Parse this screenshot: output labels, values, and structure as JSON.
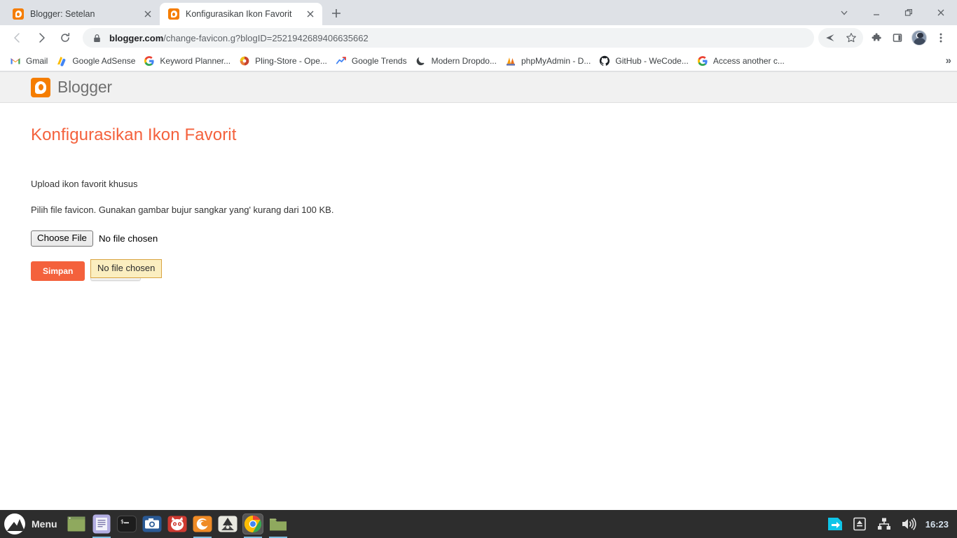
{
  "browser": {
    "tabs": [
      {
        "title": "Blogger: Setelan",
        "favicon": "blogger-icon",
        "active": false
      },
      {
        "title": "Konfigurasikan Ikon Favorit",
        "favicon": "blogger-icon",
        "active": true
      }
    ],
    "new_tab_label": "+",
    "window_controls": {
      "tab_search": "chevron-down-icon",
      "minimize": "minimize-icon",
      "maximize": "maximize-icon",
      "close": "close-icon"
    },
    "nav": {
      "back": "back-arrow-icon",
      "forward": "forward-arrow-icon",
      "reload": "reload-icon"
    },
    "omnibox": {
      "security": "lock-icon",
      "url_domain": "blogger.com",
      "url_path": "/change-favicon.g?blogID=2521942689406635662",
      "url_full": "blogger.com/change-favicon.g?blogID=2521942689406635662"
    },
    "toolbar_icons": [
      {
        "name": "share-icon"
      },
      {
        "name": "bookmark-star-icon"
      },
      {
        "name": "extensions-puzzle-icon"
      },
      {
        "name": "side-panel-icon"
      },
      {
        "name": "profile-avatar"
      },
      {
        "name": "chrome-menu-icon"
      }
    ],
    "bookmarks": [
      {
        "label": "Gmail",
        "icon": "gmail-icon"
      },
      {
        "label": "Google AdSense",
        "icon": "adsense-icon"
      },
      {
        "label": "Keyword Planner...",
        "icon": "google-g-icon"
      },
      {
        "label": "Pling-Store - Ope...",
        "icon": "pling-icon"
      },
      {
        "label": "Google Trends",
        "icon": "trends-icon"
      },
      {
        "label": "Modern Dropdo...",
        "icon": "moon-icon"
      },
      {
        "label": "phpMyAdmin - D...",
        "icon": "phpmyadmin-icon"
      },
      {
        "label": "GitHub - WeCode...",
        "icon": "github-icon"
      },
      {
        "label": "Access another c...",
        "icon": "google-g-icon"
      }
    ],
    "bookmarks_overflow": "»"
  },
  "page": {
    "brand": "Blogger",
    "brand_icon": "blogger-logo-icon",
    "title": "Konfigurasikan Ikon Favorit",
    "lead": "Upload ikon favorit khusus",
    "description": "Pilih file favicon. Gunakan gambar bujur sangkar yang' kurang dari 100 KB.",
    "file_input": {
      "button_label": "Choose File",
      "status": "No file chosen"
    },
    "save_label": "Simpan",
    "cancel_label": "Batal",
    "tooltip": "No file chosen",
    "accent_color": "#f4613c",
    "brand_orange": "#f57d00"
  },
  "taskbar": {
    "menu_label": "Menu",
    "apps": [
      {
        "name": "file-manager-icon"
      },
      {
        "name": "text-editor-icon"
      },
      {
        "name": "terminal-icon"
      },
      {
        "name": "screenshot-icon"
      },
      {
        "name": "gimp-icon"
      },
      {
        "name": "firefox-icon"
      },
      {
        "name": "inkscape-icon"
      },
      {
        "name": "chrome-icon"
      },
      {
        "name": "folder-icon"
      }
    ],
    "tray": [
      {
        "name": "updates-icon"
      },
      {
        "name": "eject-media-icon"
      },
      {
        "name": "network-icon"
      },
      {
        "name": "volume-icon"
      }
    ],
    "clock": "16:23"
  }
}
